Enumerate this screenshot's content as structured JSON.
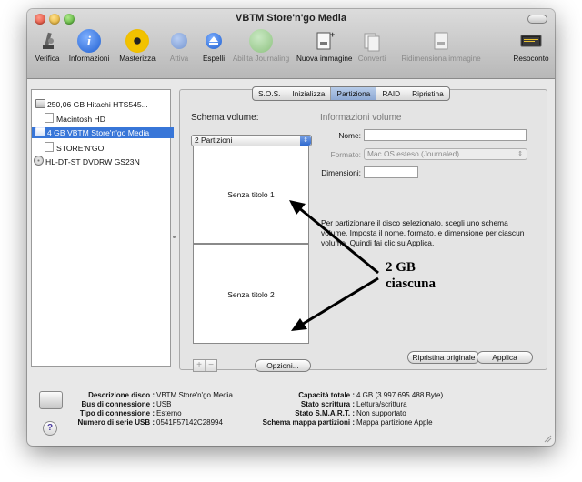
{
  "window": {
    "title": "VBTM Store'n'go Media"
  },
  "toolbar": {
    "items": [
      {
        "label": "Verifica",
        "icon": "microscope-icon",
        "enabled": true
      },
      {
        "label": "Informazioni",
        "icon": "info-icon",
        "enabled": true
      },
      {
        "label": "Masterizza",
        "icon": "burn-icon",
        "enabled": true
      },
      {
        "label": "Attiva",
        "icon": "mount-icon",
        "enabled": false
      },
      {
        "label": "Espelli",
        "icon": "eject-icon",
        "enabled": true
      },
      {
        "label": "Abilita Journaling",
        "icon": "journaling-icon",
        "enabled": false
      },
      {
        "label": "Nuova immagine",
        "icon": "new-image-icon",
        "enabled": true
      },
      {
        "label": "Converti",
        "icon": "convert-icon",
        "enabled": false
      },
      {
        "label": "Ridimensiona immagine",
        "icon": "resize-image-icon",
        "enabled": false
      },
      {
        "label": "Resoconto",
        "icon": "log-icon",
        "enabled": true
      }
    ]
  },
  "sidebar": {
    "items": [
      {
        "label": "250,06 GB Hitachi HTS545...",
        "type": "disk",
        "selected": false
      },
      {
        "label": "Macintosh HD",
        "type": "volume",
        "selected": false
      },
      {
        "label": "4 GB VBTM Store'n'go Media",
        "type": "disk",
        "selected": true
      },
      {
        "label": "STORE'N'GO",
        "type": "volume",
        "selected": false
      },
      {
        "label": "HL-DT-ST DVDRW GS23N",
        "type": "optical",
        "selected": false
      }
    ]
  },
  "tabs": [
    {
      "label": "S.O.S.",
      "active": false
    },
    {
      "label": "Inizializza",
      "active": false
    },
    {
      "label": "Partiziona",
      "active": true
    },
    {
      "label": "RAID",
      "active": false
    },
    {
      "label": "Ripristina",
      "active": false
    }
  ],
  "partition": {
    "scheme_heading": "Schema volume:",
    "scheme_value": "2 Partizioni",
    "volumes": [
      "Senza titolo 1",
      "Senza titolo 2"
    ],
    "plus_label": "+",
    "minus_label": "−",
    "options_button": "Opzioni...",
    "info_heading": "Informazioni volume",
    "name_label": "Nome:",
    "name_value": "",
    "format_label": "Formato:",
    "format_value": "Mac OS esteso (Journaled)",
    "size_label": "Dimensioni:",
    "size_value": "",
    "info_text": "Per partizionare il disco selezionato, scegli uno schema volume. Imposta il nome, formato, e dimensione per ciascun volume. Quindi fai clic su Applica.",
    "revert_button": "Ripristina originale",
    "apply_button": "Applica"
  },
  "annotation": {
    "line1": "2 GB",
    "line2": "ciascuna"
  },
  "status": {
    "left": [
      {
        "label": "Descrizione disco :",
        "value": "VBTM Store'n'go Media"
      },
      {
        "label": "Bus di connessione :",
        "value": "USB"
      },
      {
        "label": "Tipo di connessione :",
        "value": "Esterno"
      },
      {
        "label": "Numero di serie USB :",
        "value": "0541F57142C28994"
      }
    ],
    "right": [
      {
        "label": "Capacità totale :",
        "value": "4 GB (3.997.695.488 Byte)"
      },
      {
        "label": "Stato scrittura :",
        "value": "Lettura/scrittura"
      },
      {
        "label": "Stato S.M.A.R.T. :",
        "value": "Non supportato"
      },
      {
        "label": "Schema mappa partizioni :",
        "value": "Mappa partizione Apple"
      }
    ]
  },
  "help_label": "?",
  "colors": {
    "selection": "#3876d8",
    "active_tab": "#a9c1e6",
    "window_bg": "#e8e8e8"
  }
}
